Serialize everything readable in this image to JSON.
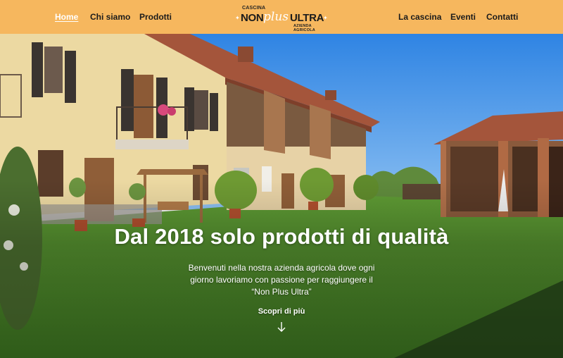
{
  "nav": {
    "left_items": [
      {
        "label": "Home",
        "active": true
      },
      {
        "label": "Chi siamo",
        "active": false
      },
      {
        "label": "Prodotti",
        "active": false
      }
    ],
    "right_items": [
      {
        "label": "La cascina",
        "active": false
      },
      {
        "label": "Eventi",
        "active": false
      },
      {
        "label": "Contatti",
        "active": false
      }
    ]
  },
  "logo": {
    "top": "CASCINA",
    "non": "NON",
    "plus": "plus",
    "ultra": "ULTRA",
    "sub": "AZIENDA AGRICOLA"
  },
  "hero": {
    "title": "Dal 2018 solo prodotti di qualità",
    "text_lines": [
      "Benvenuti nella nostra azienda agricola dove ogni",
      "giorno lavoriamo con passione per raggiungere il",
      "“Non Plus Ultra”"
    ],
    "cta_label": "Scopri di più",
    "cta_icon": "arrow-down-icon"
  },
  "colors": {
    "nav_bg": "#f6b75e",
    "active_link": "#ffffff",
    "text_dark": "#1b1b1b",
    "sky": "#3b8fe6",
    "grass": "#4f8a2a",
    "wall": "#ead9a3",
    "roof": "#a8573c"
  }
}
